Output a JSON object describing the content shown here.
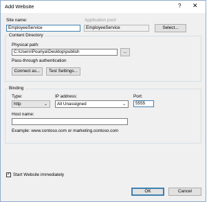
{
  "window": {
    "title": "Add Website",
    "help": "?",
    "close": "✕"
  },
  "site": {
    "name_label": "Site name:",
    "name_value": "EmployeeService",
    "pool_label": "Application pool:",
    "pool_value": "EmployeeService",
    "select_button": "Select..."
  },
  "content_directory": {
    "group_title": "Content Directory",
    "physical_path_label": "Physical path:",
    "physical_path_value": "C:\\Users\\Pouriya\\Desktop\\publish",
    "browse_button": "...",
    "auth_text": "Pass-through authentication",
    "connect_button": "Connect as...",
    "test_button": "Test Settings..."
  },
  "binding": {
    "group_title": "Binding",
    "type_label": "Type:",
    "type_value": "http",
    "ip_label": "IP address:",
    "ip_value": "All Unassigned",
    "port_label": "Port:",
    "port_value": "5555",
    "host_label": "Host name:",
    "host_value": "",
    "example_text": "Example: www.contoso.com or marketing.contoso.com"
  },
  "start_immediately": {
    "label": "Start Website immediately",
    "checked": true,
    "mark": "✓"
  },
  "footer": {
    "ok": "OK",
    "cancel": "Cancel"
  }
}
